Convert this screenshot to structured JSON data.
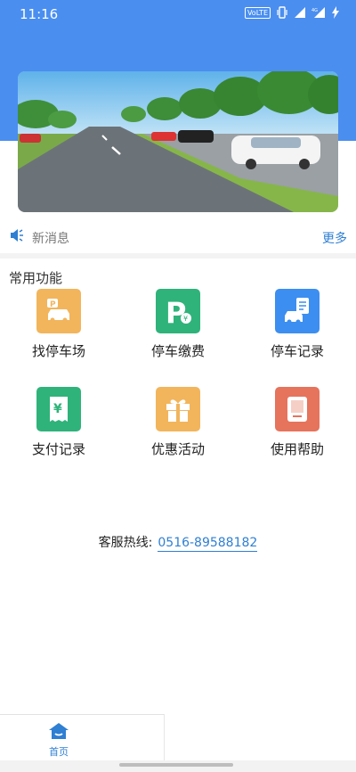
{
  "status_bar": {
    "time": "11:16",
    "network_label": "VoLTE",
    "signal_label": "4G"
  },
  "notice": {
    "text": "新消息",
    "more_label": "更多"
  },
  "functions": {
    "title": "常用功能",
    "items": [
      {
        "label": "找停车场",
        "icon": "car-parking-icon",
        "color": "#f2b55c"
      },
      {
        "label": "停车缴费",
        "icon": "parking-pay-icon",
        "color": "#2fb37a"
      },
      {
        "label": "停车记录",
        "icon": "car-record-icon",
        "color": "#3c8ef0"
      },
      {
        "label": "支付记录",
        "icon": "yuan-receipt-icon",
        "color": "#2fb37a"
      },
      {
        "label": "优惠活动",
        "icon": "gift-icon",
        "color": "#f2b55c"
      },
      {
        "label": "使用帮助",
        "icon": "help-book-icon",
        "color": "#e6735c"
      }
    ]
  },
  "hotline": {
    "label": "客服热线:",
    "phone": "0516-89588182"
  },
  "tabbar": {
    "home_label": "首页"
  },
  "colors": {
    "primary": "#4a8ef0",
    "link": "#2f7fd3"
  }
}
